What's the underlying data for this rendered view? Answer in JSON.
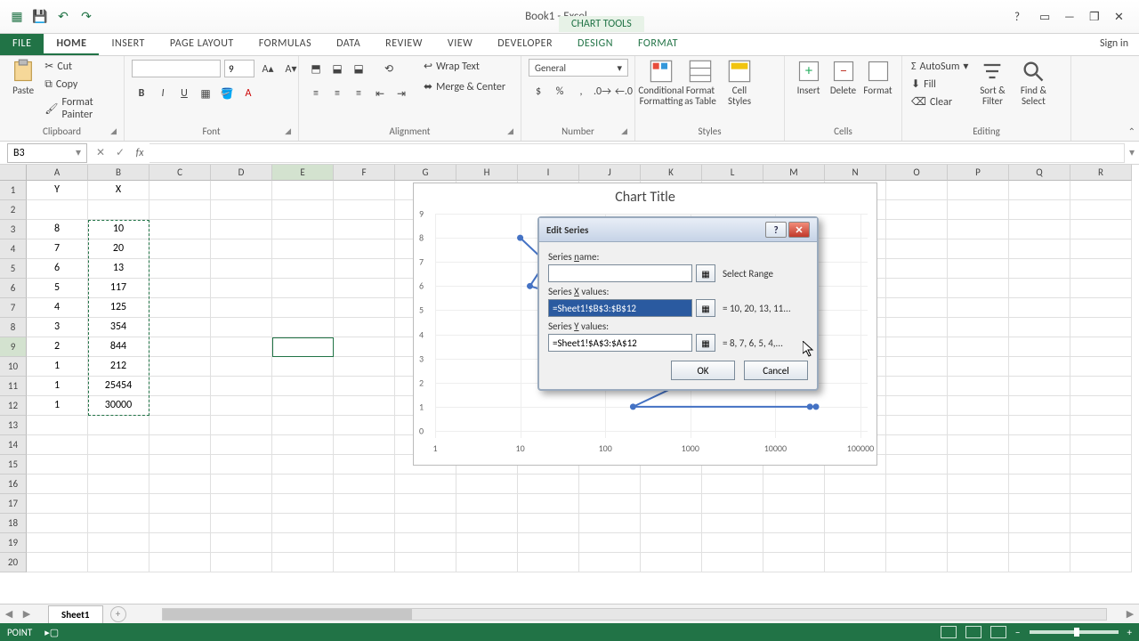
{
  "app": {
    "title": "Book1 - Excel",
    "chart_tools": "CHART TOOLS"
  },
  "qat": {
    "save": "💾",
    "undo": "↶",
    "redo": "↷"
  },
  "win": {
    "help": "?",
    "ribbonopts": "▭",
    "min": "—",
    "restore": "❐",
    "close": "✕"
  },
  "tabs": {
    "file": "FILE",
    "home": "HOME",
    "insert": "INSERT",
    "pagelayout": "PAGE LAYOUT",
    "formulas": "FORMULAS",
    "data": "DATA",
    "review": "REVIEW",
    "view": "VIEW",
    "developer": "DEVELOPER",
    "design": "DESIGN",
    "format": "FORMAT",
    "signin": "Sign in"
  },
  "ribbon": {
    "clipboard": {
      "title": "Clipboard",
      "paste": "Paste",
      "cut": "Cut",
      "copy": "Copy",
      "fmtpainter": "Format Painter"
    },
    "font": {
      "title": "Font",
      "size": "9"
    },
    "alignment": {
      "title": "Alignment",
      "wrap": "Wrap Text",
      "merge": "Merge & Center"
    },
    "number": {
      "title": "Number",
      "general": "General"
    },
    "styles": {
      "title": "Styles",
      "cond": "Conditional Formatting",
      "table": "Format as Table",
      "cell": "Cell Styles"
    },
    "cells": {
      "title": "Cells",
      "insert": "Insert",
      "delete": "Delete",
      "format": "Format"
    },
    "editing": {
      "title": "Editing",
      "autosum": "AutoSum",
      "fill": "Fill",
      "clear": "Clear",
      "sort": "Sort & Filter",
      "find": "Find & Select"
    }
  },
  "namebox": "B3",
  "columns": [
    "A",
    "B",
    "C",
    "D",
    "E",
    "F",
    "G",
    "H",
    "I",
    "J",
    "K",
    "L",
    "M",
    "N",
    "O",
    "P",
    "Q",
    "R"
  ],
  "rows": [
    "1",
    "2",
    "3",
    "4",
    "5",
    "6",
    "7",
    "8",
    "9",
    "10",
    "11",
    "12",
    "13",
    "14",
    "15",
    "16",
    "17",
    "18",
    "19",
    "20"
  ],
  "cells": {
    "A1": "Y",
    "B1": "X",
    "A3": "8",
    "B3": "10",
    "A4": "7",
    "B4": "20",
    "A5": "6",
    "B5": "13",
    "A6": "5",
    "B6": "117",
    "A7": "4",
    "B7": "125",
    "A8": "3",
    "B8": "354",
    "A9": "2",
    "B9": "844",
    "A10": "1",
    "B10": "212",
    "A11": "1",
    "B11": "25454",
    "A12": "1",
    "B12": "30000"
  },
  "chart": {
    "title": "Chart Title"
  },
  "chart_data": {
    "type": "scatter",
    "title": "Chart Title",
    "xlabel": "",
    "ylabel": "",
    "x_scale": "log",
    "xlim": [
      1,
      100000
    ],
    "ylim": [
      0,
      9
    ],
    "x_ticks": [
      1,
      10,
      100,
      1000,
      10000,
      100000
    ],
    "y_ticks": [
      0,
      1,
      2,
      3,
      4,
      5,
      6,
      7,
      8,
      9
    ],
    "series": [
      {
        "name": "",
        "x": [
          10,
          20,
          13,
          117,
          125,
          354,
          844,
          212,
          25454,
          30000
        ],
        "y": [
          8,
          7,
          6,
          5,
          4,
          3,
          2,
          1,
          1,
          1
        ]
      }
    ]
  },
  "dialog": {
    "title": "Edit Series",
    "series_name_lbl": "Series name:",
    "series_name_hint": "Select Range",
    "series_x_lbl": "Series X values:",
    "series_x_val": "=Sheet1!$B$3:$B$12",
    "series_x_eq": "= 10, 20, 13, 11...",
    "series_y_lbl": "Series Y values:",
    "series_y_val": "=Sheet1!$A$3:$A$12",
    "series_y_eq": "= 8, 7, 6, 5, 4,...",
    "ok": "OK",
    "cancel": "Cancel"
  },
  "sheet_tab": "Sheet1",
  "status": {
    "mode": "POINT",
    "zoom": ""
  }
}
